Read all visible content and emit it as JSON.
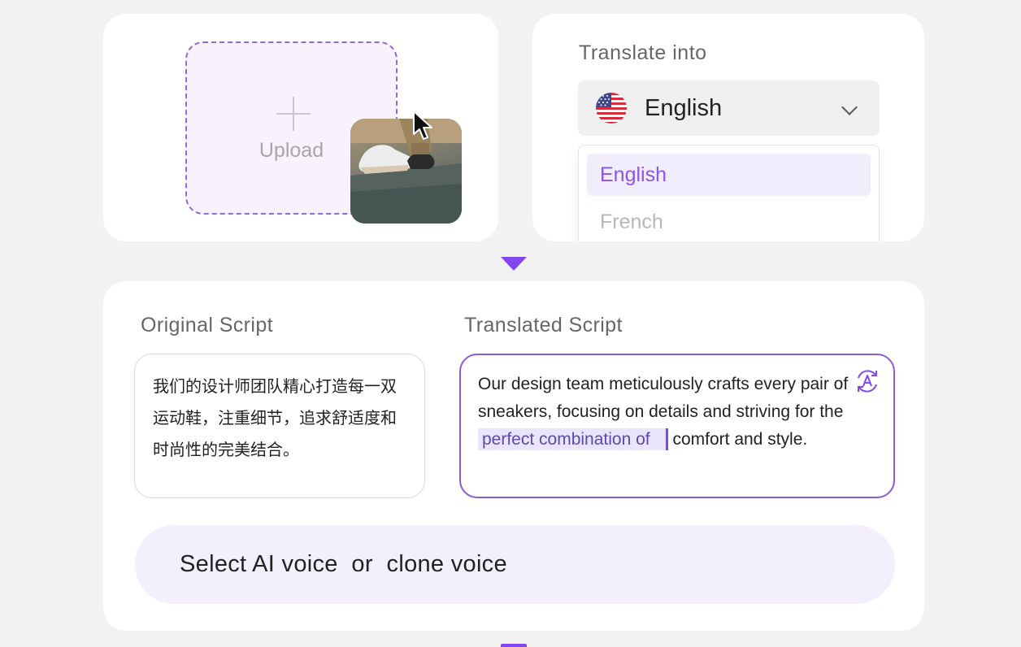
{
  "upload": {
    "label": "Upload"
  },
  "translate": {
    "title": "Translate into",
    "selected_language": "English",
    "options": [
      "English",
      "French"
    ]
  },
  "script": {
    "original_title": "Original Script",
    "translated_title": "Translated Script",
    "original_text": "我们的设计师团队精心打造每一双运动鞋，注重细节，追求舒适度和时尚性的完美结合。",
    "translated_text_before": "Our design team meticulously crafts every pair of sneakers, focusing on details and striving for the",
    "translated_text_highlight": "perfect combination of",
    "translated_text_after": "comfort and style."
  },
  "voice": {
    "label": "Select AI voice  or  clone voice"
  },
  "colors": {
    "accent": "#8346f0",
    "highlight_bg": "#ebe4fd",
    "selected_text": "#8b55e6"
  },
  "icons": [
    "plus-icon",
    "cursor-icon",
    "us-flag-icon",
    "chevron-down-icon",
    "arrow-down-icon",
    "ai-translate-icon",
    "waveform-icon"
  ]
}
